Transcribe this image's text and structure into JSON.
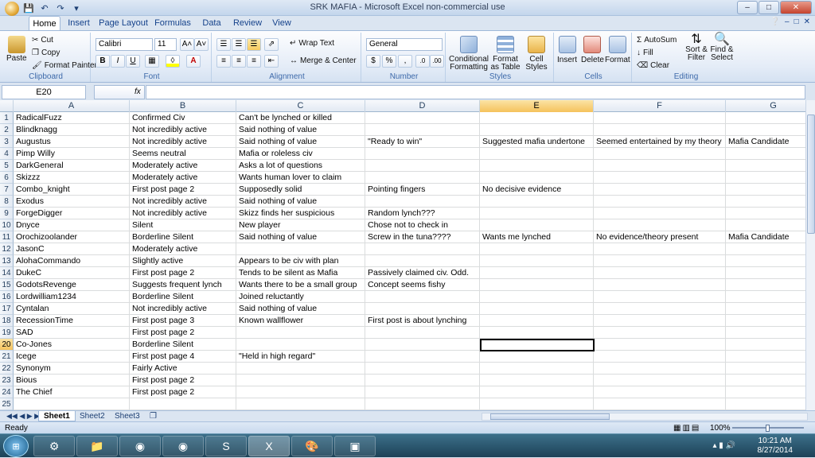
{
  "window": {
    "title": "SRK MAFIA - Microsoft Excel non-commercial use"
  },
  "tabs": [
    "Home",
    "Insert",
    "Page Layout",
    "Formulas",
    "Data",
    "Review",
    "View"
  ],
  "ribbon": {
    "clipboard": {
      "paste": "Paste",
      "cut": "Cut",
      "copy": "Copy",
      "format_painter": "Format Painter",
      "label": "Clipboard"
    },
    "font": {
      "name": "Calibri",
      "size": "11",
      "label": "Font"
    },
    "alignment": {
      "wrap_text": "Wrap Text",
      "merge": "Merge & Center",
      "label": "Alignment"
    },
    "number": {
      "format": "General",
      "label": "Number"
    },
    "styles": {
      "conditional": "Conditional Formatting",
      "table": "Format as Table",
      "cell": "Cell Styles",
      "label": "Styles"
    },
    "cells": {
      "insert": "Insert",
      "delete": "Delete",
      "format": "Format",
      "label": "Cells"
    },
    "editing": {
      "autosum": "AutoSum",
      "fill": "Fill",
      "clear": "Clear",
      "sort": "Sort & Filter",
      "find": "Find & Select",
      "label": "Editing"
    }
  },
  "formula_bar": {
    "name_box": "E20",
    "fx": "fx",
    "content": ""
  },
  "columns": [
    "A",
    "B",
    "C",
    "D",
    "E",
    "F",
    "G"
  ],
  "rows": [
    [
      "RadicalFuzz",
      "Confirmed Civ",
      "Can't be lynched or killed",
      "",
      "",
      "",
      ""
    ],
    [
      "Blindknagg",
      "Not incredibly active",
      "Said nothing of value",
      "",
      "",
      "",
      ""
    ],
    [
      "Augustus",
      "Not incredibly active",
      "Said nothing of value",
      "\"Ready to win\"",
      "Suggested mafia undertone",
      "Seemed entertained by my theory",
      "Mafia Candidate"
    ],
    [
      "Pimp Willy",
      "Seems neutral",
      "Mafia or roleless civ",
      "",
      "",
      "",
      ""
    ],
    [
      "DarkGeneral",
      "Moderately active",
      "Asks a lot of questions",
      "",
      "",
      "",
      ""
    ],
    [
      "Skizzz",
      "Moderately active",
      "Wants human lover to claim",
      "",
      "",
      "",
      ""
    ],
    [
      "Combo_knight",
      "First post page 2",
      "Supposedly solid",
      "Pointing fingers",
      "No decisive evidence",
      "",
      ""
    ],
    [
      "Exodus",
      "Not incredibly active",
      "Said nothing of value",
      "",
      "",
      "",
      ""
    ],
    [
      "ForgeDigger",
      "Not incredibly active",
      "Skizz finds her suspicious",
      "Random lynch???",
      "",
      "",
      ""
    ],
    [
      "Dnyce",
      "Silent",
      "New player",
      "Chose not to check in",
      "",
      "",
      ""
    ],
    [
      "Orochizoolander",
      "Borderline Silent",
      "Said nothing of value",
      "Screw in the tuna????",
      "Wants me lynched",
      "No evidence/theory present",
      "Mafia Candidate"
    ],
    [
      "JasonC",
      "Moderately active",
      "",
      "",
      "",
      "",
      ""
    ],
    [
      "AlohaCommando",
      "Slightly active",
      "Appears to be civ with plan",
      "",
      "",
      "",
      ""
    ],
    [
      "DukeC",
      "First post page 2",
      "Tends to be silent as Mafia",
      "Passively claimed civ. Odd.",
      "",
      "",
      ""
    ],
    [
      "GodotsRevenge",
      "Suggests frequent lynch",
      "Wants there to be a small group",
      "Concept seems fishy",
      "",
      "",
      ""
    ],
    [
      "Lordwilliam1234",
      "Borderline Silent",
      "Joined reluctantly",
      "",
      "",
      "",
      ""
    ],
    [
      "Cyntalan",
      "Not incredibly active",
      "Said nothing of value",
      "",
      "",
      "",
      ""
    ],
    [
      "RecessionTime",
      "First post page 3",
      "Known wallflower",
      "First post is about lynching",
      "",
      "",
      ""
    ],
    [
      "SAD",
      "First post page 2",
      "",
      "",
      "",
      "",
      ""
    ],
    [
      "Co-Jones",
      "Borderline Silent",
      "",
      "",
      "",
      "",
      ""
    ],
    [
      "Icege",
      "First post page 4",
      "\"Held in high regard\"",
      "",
      "",
      "",
      ""
    ],
    [
      "Synonym",
      "Fairly Active",
      "",
      "",
      "",
      "",
      ""
    ],
    [
      "Bious",
      "First post page 2",
      "",
      "",
      "",
      "",
      ""
    ],
    [
      "The Chief",
      "First post page 2",
      "",
      "",
      "",
      "",
      ""
    ],
    [
      "",
      "",
      "",
      "",
      "",
      "",
      ""
    ]
  ],
  "row_numbers": [
    "1",
    "2",
    "3",
    "4",
    "5",
    "6",
    "7",
    "8",
    "9",
    "10",
    "11",
    "12",
    "13",
    "14",
    "15",
    "16",
    "17",
    "18",
    "19",
    "20",
    "21",
    "22",
    "23",
    "24",
    "25"
  ],
  "sheets": [
    "Sheet1",
    "Sheet2",
    "Sheet3"
  ],
  "status": {
    "ready": "Ready",
    "zoom": "100%"
  },
  "clock": {
    "time": "10:21 AM",
    "date": "8/27/2014"
  }
}
